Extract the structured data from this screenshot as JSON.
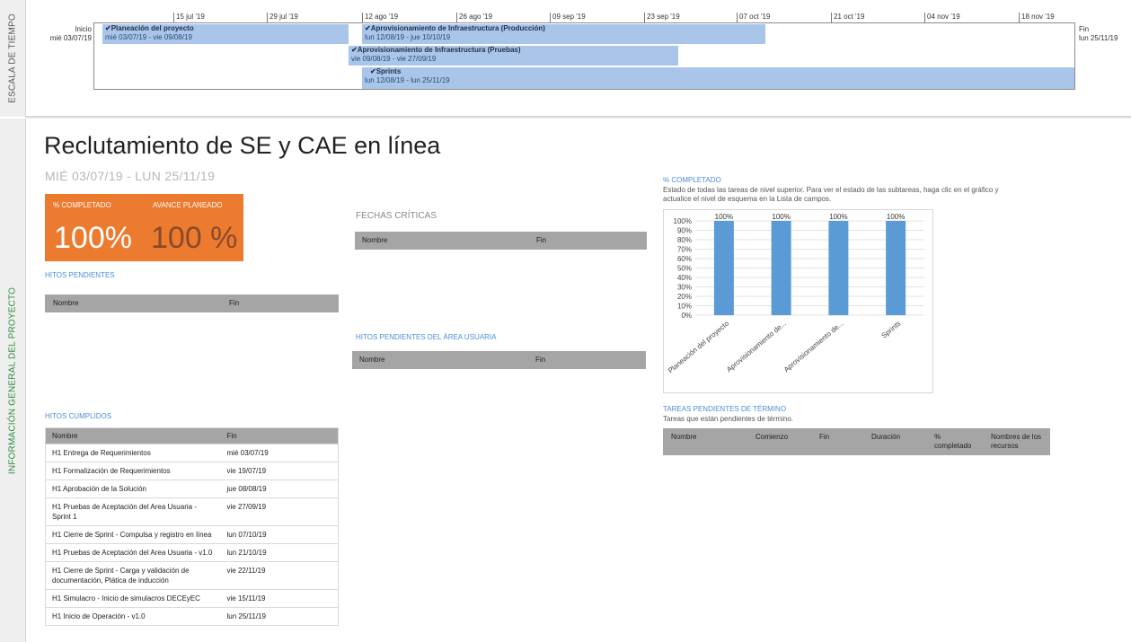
{
  "side": {
    "timeline_label": "ESCALA DE TIEMPO",
    "info_label": "INFORMACIÓN GENERAL DEL PROYECTO"
  },
  "timeline": {
    "start_label": "Inicio",
    "start_date": "mié 03/07/19",
    "end_label": "Fin",
    "end_date": "lun 25/11/19",
    "ticks": [
      "15 jul '19",
      "29 jul '19",
      "12 ago '19",
      "26 ago '19",
      "09 sep '19",
      "23 sep '19",
      "07 oct '19",
      "21 oct '19",
      "04 nov '19",
      "18 nov '19"
    ],
    "bars": [
      {
        "name": "Planeación del proyecto",
        "dates": "mié 03/07/19 - vie 09/08/19"
      },
      {
        "name": "Aprovisionamiento de Infraestructura (Producción)",
        "dates": "lun 12/08/19 - jue 10/10/19"
      },
      {
        "name": "Aprovisionamiento de Infraestructura (Pruebas)",
        "dates": "vie 09/08/19 - vie 27/09/19"
      },
      {
        "name": "Sprints",
        "dates": "lun 12/08/19 - lun 25/11/19"
      }
    ]
  },
  "main": {
    "title": "Reclutamiento de SE y CAE en línea",
    "subtitle": "MIÉ 03/07/19 -  LUN 25/11/19",
    "kpi": {
      "completed_label": "% COMPLETADO",
      "completed_value": "100%",
      "planned_label": "AVANCE PLANEADO",
      "planned_value": "100 %"
    },
    "hitos_pendientes": {
      "title": "HITOS PENDIENTES",
      "col_name": "Nombre",
      "col_end": "Fin"
    },
    "fechas_criticas": {
      "title": "FECHAS CRÍTICAS",
      "col_name": "Nombre",
      "col_end": "Fin"
    },
    "hitos_area": {
      "title": "HITOS PENDIENTES DEL ÁREA USUARIA",
      "col_name": "Nombre",
      "col_end": "Fin"
    },
    "hitos_cumplidos": {
      "title": "HITOS CUMPLIDOS",
      "col_name": "Nombre",
      "col_end": "Fin",
      "rows": [
        {
          "name": "H1 Entrega de Requerimientos",
          "end": "mié 03/07/19"
        },
        {
          "name": "H1 Formalización de Requerimientos",
          "end": "vie 19/07/19"
        },
        {
          "name": "H1 Aprobación de la Solución",
          "end": "jue 08/08/19"
        },
        {
          "name": "H1 Pruebas de Aceptación del Area Usuaria - Sprint 1",
          "end": "vie 27/09/19"
        },
        {
          "name": "H1 Cierre de Sprint - Compulsa y registro en línea",
          "end": "lun 07/10/19"
        },
        {
          "name": "H1 Pruebas de Aceptación del Area Usuaria - v1.0",
          "end": "lun 21/10/19"
        },
        {
          "name": "H1 Cierre de Sprint - Carga y validación de documentación, Plática de inducción",
          "end": "vie 22/11/19"
        },
        {
          "name": "H1 Simulacro - Inicio de simulacros DECEyEC",
          "end": "vie 15/11/19"
        },
        {
          "name": "H1 Inicio de Operación - v1.0",
          "end": "lun 25/11/19"
        }
      ]
    },
    "pct_section": {
      "title": "% COMPLETADO",
      "description": "Estado de todas las tareas de nivel superior. Para ver el estado de las subtareas, haga clic en el gráfico y actualice el nivel de esquema en la Lista de campos."
    },
    "tareas_pendientes": {
      "title": "TAREAS PENDIENTES DE TÉRMINO",
      "description": "Tareas que están pendientes de término.",
      "cols": [
        "Nombre",
        "Comienzo",
        "Fin",
        "Duración",
        "% completado",
        "Nombres de los recursos"
      ]
    }
  },
  "chart_data": {
    "type": "bar",
    "categories": [
      "Planeación del proyecto",
      "Aprovisionamiento de...",
      "Aprovisionamiento de...",
      "Sprints"
    ],
    "values": [
      100,
      100,
      100,
      100
    ],
    "data_labels": [
      "100%",
      "100%",
      "100%",
      "100%"
    ],
    "ylim": [
      0,
      100
    ],
    "yticks": [
      "0%",
      "10%",
      "20%",
      "30%",
      "40%",
      "50%",
      "60%",
      "70%",
      "80%",
      "90%",
      "100%"
    ],
    "grid": true,
    "bar_color": "#5b9bd5"
  },
  "colors": {
    "kpi_bg": "#ec7b30",
    "section_title": "#4a8ed8",
    "timeline_bar": "#a9c6ea",
    "table_header": "#a5a5a5"
  }
}
